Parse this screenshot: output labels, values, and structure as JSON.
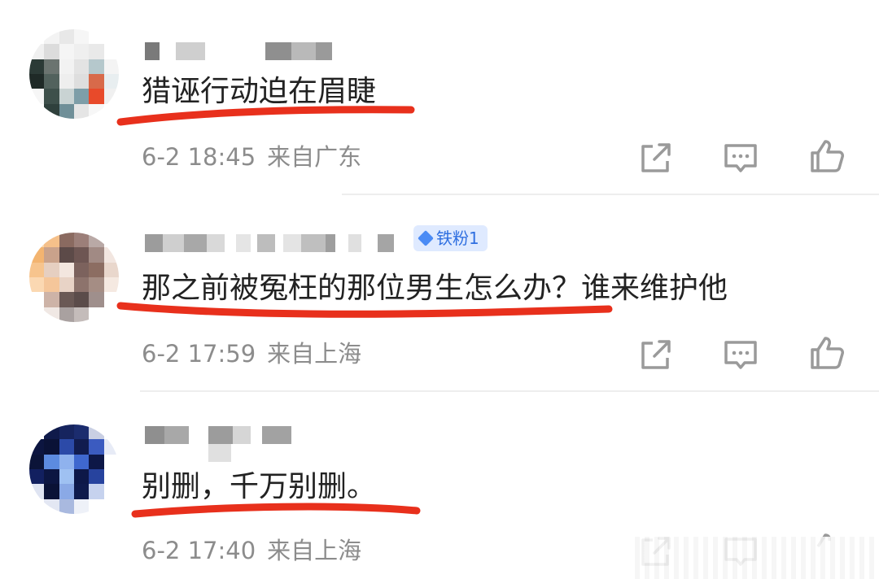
{
  "comments": [
    {
      "text": "猎诬行动迫在眉睫",
      "date": "6-2 18:45",
      "location": "来自广东",
      "badge": null
    },
    {
      "text": "那之前被冤枉的那位男生怎么办？谁来维护他",
      "date": "6-2 17:59",
      "location": "来自上海",
      "badge": "铁粉1"
    },
    {
      "text": "别删，千万别删。",
      "date": "6-2 17:40",
      "location": "来自上海",
      "badge": null
    }
  ],
  "icons": {
    "share": "share-icon",
    "comment": "comment-icon",
    "like": "thumbs-up-icon"
  },
  "colors": {
    "underline": "#e8301c",
    "meta_text": "#8c8c8c",
    "badge_bg": "#dfeaff",
    "badge_text": "#2f6fe0",
    "icon": "#9a9a9a"
  }
}
